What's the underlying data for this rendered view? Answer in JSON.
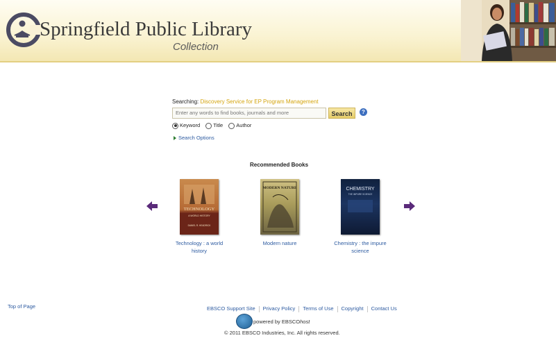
{
  "header": {
    "brand": "Springfield Public Library",
    "subtitle": "Collection"
  },
  "search": {
    "searching_label": "Searching:",
    "database": "Discovery Service for EP Program Management",
    "placeholder": "Enter any words to find books, journals and more",
    "button_label": "Search",
    "help": "?",
    "radios": [
      {
        "label": "Keyword",
        "selected": true
      },
      {
        "label": "Title",
        "selected": false
      },
      {
        "label": "Author",
        "selected": false
      }
    ],
    "options_label": "Search Options"
  },
  "recommended": {
    "title": "Recommended Books",
    "books": [
      {
        "cover_title": "TECHNOLOGY",
        "cover_subtitle": "A WORLD HISTORY",
        "cover_author": "DANIEL R. HEADRICK",
        "caption": "Technology : a world history"
      },
      {
        "cover_title": "MODERN NATURE",
        "caption": "Modern nature"
      },
      {
        "cover_title": "CHEMISTRY",
        "cover_subtitle": "THE IMPURE SCIENCE",
        "caption_line1": "Chemistry : the impure",
        "caption_line2": "science"
      }
    ]
  },
  "footer": {
    "top_of_page": "Top of Page",
    "links": [
      "EBSCO Support Site",
      "Privacy Policy",
      "Terms of Use",
      "Copyright",
      "Contact Us"
    ],
    "powered_prefix": "powered by EBSCO",
    "powered_suffix": "host",
    "copyright": "© 2011 EBSCO Industries, Inc. All rights reserved."
  },
  "colors": {
    "accent_gold": "#d4a40c",
    "link_blue": "#2c5aa0",
    "arrow_purple": "#5a2a7a"
  },
  "icons": [
    "library-logo-icon",
    "help-icon",
    "arrow-left-icon",
    "arrow-right-icon",
    "triangle-right-icon",
    "ebsco-logo-icon"
  ]
}
